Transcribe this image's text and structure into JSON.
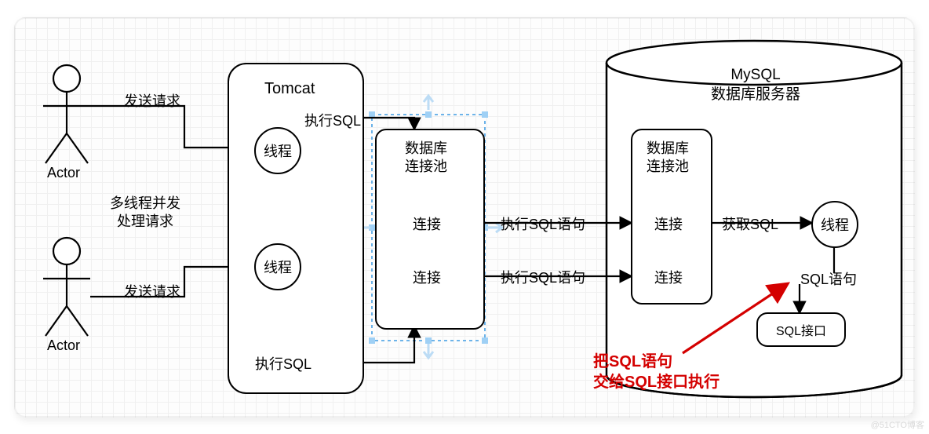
{
  "actor1_label": "Actor",
  "actor2_label": "Actor",
  "send_request": "发送请求",
  "multi_thread": "多线程并发\n处理请求",
  "tomcat_title": "Tomcat",
  "thread1": "线程",
  "thread2": "线程",
  "exec_sql_top": "执行SQL",
  "exec_sql_bottom": "执行SQL",
  "pool1_title": "数据库\n连接池",
  "conn_a": "连接",
  "conn_b": "连接",
  "exec_stmt_1": "执行SQL语句",
  "exec_stmt_2": "执行SQL语句",
  "mysql_title": "MySQL\n数据库服务器",
  "pool2_title": "数据库\n连接池",
  "conn_c": "连接",
  "conn_d": "连接",
  "get_sql": "获取SQL",
  "thread3": "线程",
  "sql_stmt": "SQL语句",
  "sql_interface": "SQL接口",
  "red_note": "把SQL语句\n交给SQL接口执行",
  "watermark": "@51CTO博客"
}
